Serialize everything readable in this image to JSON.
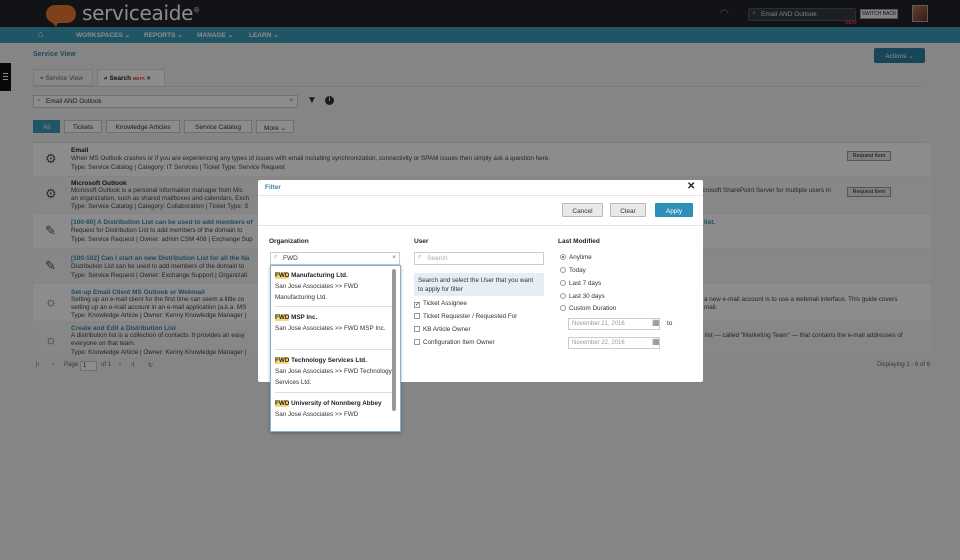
{
  "topbar": {
    "logo": "serviceaide",
    "logo_mark": "®",
    "search_value": "Email AND Outlook",
    "new_badge": "NEW",
    "switch_back": "SWITCH BACK"
  },
  "nav": {
    "items": [
      "WORKSPACES",
      "REPORTS",
      "MANAGE",
      "LEARN"
    ]
  },
  "page": {
    "title": "Service View",
    "actions": "Actions"
  },
  "tabs": {
    "service_view": "Service View",
    "search": "Search",
    "beta": "BETA"
  },
  "search": {
    "query": "Email AND Outlook"
  },
  "chips": [
    "All",
    "Tickets",
    "Knowledge Articles",
    "Service Catalog",
    "More"
  ],
  "results": [
    {
      "title": "Email",
      "line1": "When MS Outlook crashes or if you are experiencing any types of issues with email including synchronization, connectivity or SPAM issues then simply ask a question here.",
      "line2": "",
      "meta": "Type: Service Catalog | Category: IT Services | Ticket Type: Service Request",
      "button": "Request Item"
    },
    {
      "title": "Microsoft Outlook",
      "line1": "Microsoft Outlook is a personal information manager from Mic",
      "line2": "an organization, such as shared mailboxes and calendars, Exch",
      "meta": "Type: Service Catalog | Category: Collaboration | Ticket Type: S",
      "right1": "icrosoft SharePoint Server for multiple users in",
      "button": "Request Item"
    },
    {
      "title": "[100-80] A Distribution List can be used to add members of",
      "line1": "Request for Distribution List to add members of the domain to",
      "line2": "",
      "meta": "Type: Service Request | Owner: admin CSM 408 | Exchange Sup",
      "right1": "list."
    },
    {
      "title": "[100-102] Can I start an new Distribution List for all the Na",
      "line1": "Distribution List can be used to add members of the domain to",
      "line2": "",
      "meta": "Type: Service Request | Owner: Exchange Support | Organizati"
    },
    {
      "title": "Set-up Email Client MS Outlook or Webmail",
      "line1": "Setting up an e-mail client for the first time can seem a little co",
      "line2": "setting up an e-mail account in an e-mail application (a.k.a. MS",
      "meta": "Type: Knowledge Article | Owner: Kenny Knowledge Manager |",
      "right1": "a new e-mail account is to use a webmail interface. This guide covers",
      "right2": "mail."
    },
    {
      "title": "Create and Edit a Distribution List",
      "line1": "A distribution list is a collection of contacts. It provides an easy",
      "line2": "everyone on that team.",
      "meta": "Type: Knowledge Article | Owner: Kenny Knowledge Manager |",
      "right1": "list — called \"Marketing Team\" — that contains the e-mail addresses of"
    }
  ],
  "pager": {
    "page_label": "Page",
    "page": "1",
    "of": "of 1",
    "displaying": "Displaying 1 - 6 of 6"
  },
  "filter": {
    "title": "Filter",
    "cancel": "Cancel",
    "clear": "Clear",
    "apply": "Apply",
    "organization": {
      "label": "Organization",
      "value": "FWD",
      "items": [
        {
          "highlight": "FWD",
          "name": " Manufacturing Ltd.",
          "path": "San Jose Associates >> FWD Manufacturing Ltd."
        },
        {
          "highlight": "FWD",
          "name": " MSP Inc.",
          "path": "San Jose Associates >> FWD MSP Inc."
        },
        {
          "highlight": "FWD",
          "name": " Technology Services Ltd.",
          "path": "San Jose Associates >> FWD Technology Services Ltd."
        },
        {
          "highlight": "FWD",
          "name": " University of Nonnberg Abbey",
          "path": "San Jose Associates >> FWD"
        }
      ]
    },
    "user": {
      "label": "User",
      "placeholder": "Search",
      "hint": "Search and select the User that you want to apply for filter",
      "options": [
        {
          "label": "Ticket Assignee",
          "checked": true
        },
        {
          "label": "Ticket Requester / Requested For",
          "checked": false
        },
        {
          "label": "KB Article Owner",
          "checked": false
        },
        {
          "label": "Configuration Item Owner",
          "checked": false
        }
      ]
    },
    "last_modified": {
      "label": "Last Modified",
      "options": [
        "Anytime",
        "Today",
        "Last 7 days",
        "Last 30 days",
        "Custom Duration"
      ],
      "selected": "Anytime",
      "from": "November 21, 2016",
      "to_label": "to",
      "to": "November 22, 2016"
    }
  }
}
